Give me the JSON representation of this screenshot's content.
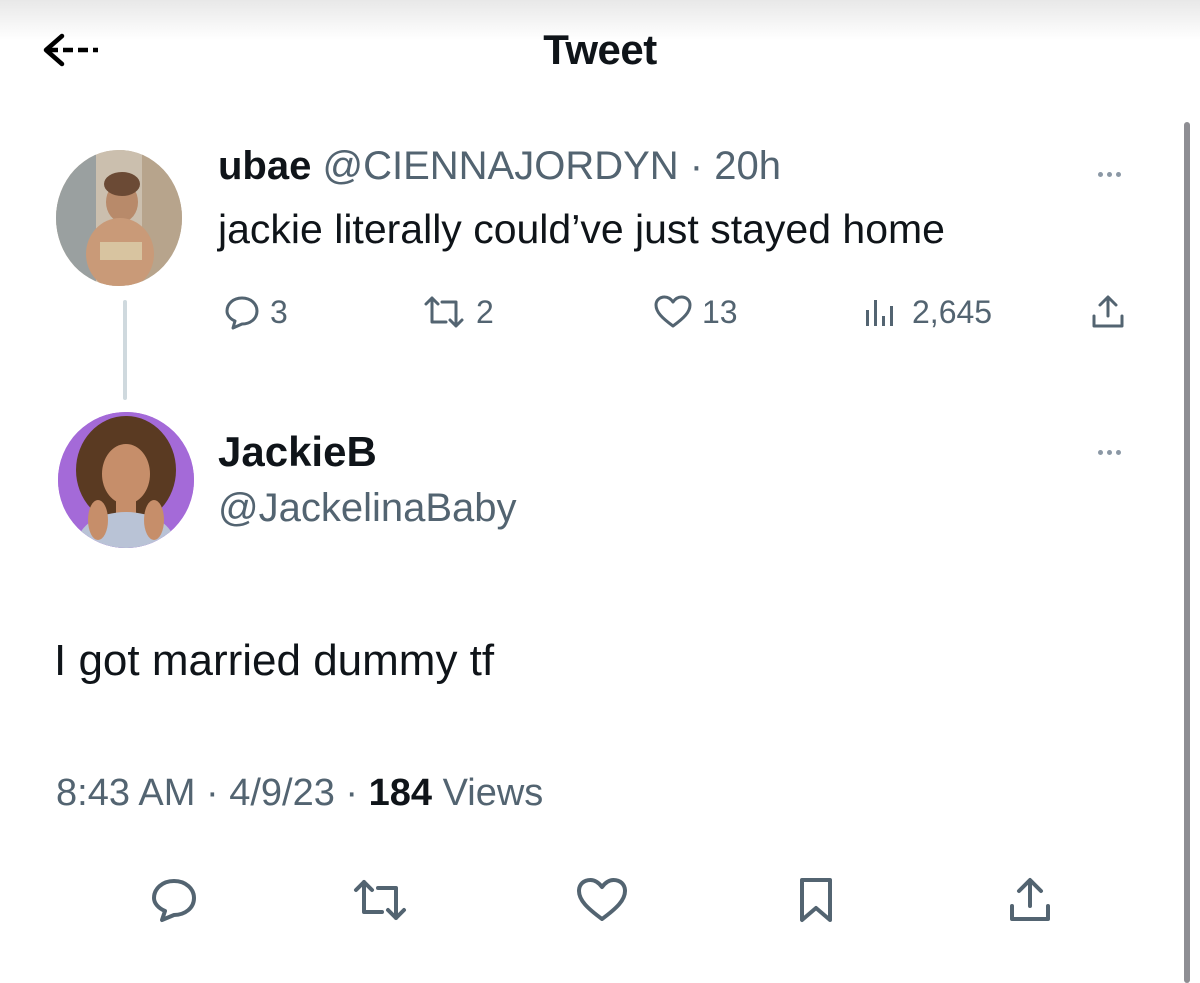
{
  "header": {
    "title": "Tweet",
    "back_icon": "arrow-left-icon"
  },
  "quoted_tweet": {
    "display_name": "ubae",
    "handle_and_time": "@CIENNAJORDYN · 20h",
    "text": "jackie literally could’ve just stayed home",
    "metrics": {
      "replies": "3",
      "retweets": "2",
      "likes": "13",
      "views": "2,645"
    }
  },
  "tweet": {
    "display_name": "JackieB",
    "handle": "@JackelinaBaby",
    "text": "I got married dummy tf",
    "time": "8:43 AM",
    "date": "4/9/23",
    "views_count": "184",
    "views_label": "Views"
  },
  "colors": {
    "primary_text": "#0f1419",
    "secondary_text": "#536471",
    "avatar2_background": "#a46ad8"
  }
}
